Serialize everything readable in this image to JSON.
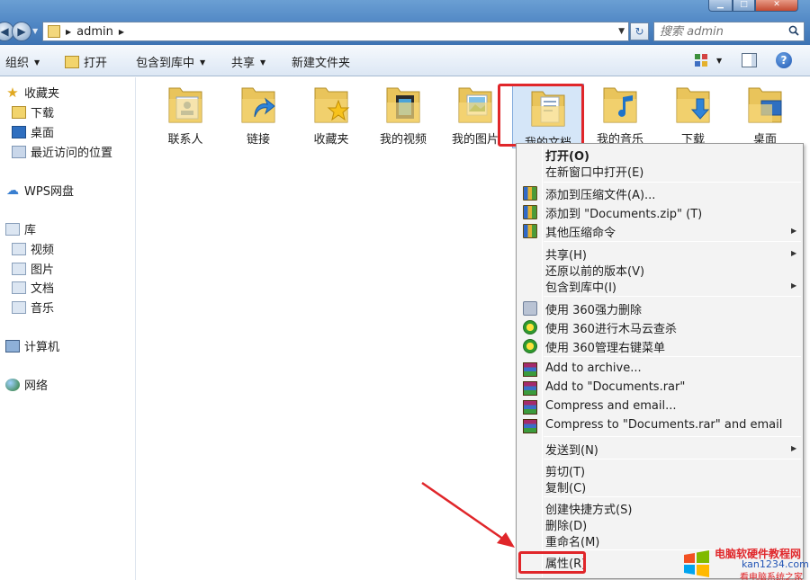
{
  "address_bar": {
    "path": [
      "admin"
    ],
    "search_placeholder": "搜索 admin"
  },
  "toolbar": {
    "organize": "组织",
    "open": "打开",
    "include_in_library": "包含到库中",
    "share": "共享",
    "new_folder": "新建文件夹"
  },
  "sidebar": {
    "favorites": "收藏夹",
    "downloads": "下载",
    "desktop": "桌面",
    "recent": "最近访问的位置",
    "wps": "WPS网盘",
    "libraries": "库",
    "videos": "视频",
    "pictures": "图片",
    "documents": "文档",
    "music": "音乐",
    "computer": "计算机",
    "network": "网络"
  },
  "folders": [
    {
      "label": "联系人",
      "icon": "contacts-folder-icon"
    },
    {
      "label": "链接",
      "icon": "links-folder-icon"
    },
    {
      "label": "收藏夹",
      "icon": "favorites-folder-icon"
    },
    {
      "label": "我的视频",
      "icon": "videos-folder-icon"
    },
    {
      "label": "我的图片",
      "icon": "pictures-folder-icon"
    },
    {
      "label": "我的文档",
      "icon": "documents-folder-icon",
      "selected": true
    },
    {
      "label": "我的音乐",
      "icon": "music-folder-icon"
    },
    {
      "label": "下载",
      "icon": "downloads-folder-icon"
    },
    {
      "label": "桌面",
      "icon": "desktop-folder-icon"
    }
  ],
  "context_menu": {
    "open": "打开(O)",
    "open_new_window": "在新窗口中打开(E)",
    "add_to_zip_archive": "添加到压缩文件(A)...",
    "add_to_documents_zip": "添加到 \"Documents.zip\" (T)",
    "other_compress": "其他压缩命令",
    "share": "共享(H)",
    "restore_previous": "还原以前的版本(V)",
    "include_in_library": "包含到库中(I)",
    "del_360": "使用 360强力删除",
    "scan_360": "使用 360进行木马云查杀",
    "manage_360": "使用 360管理右键菜单",
    "add_to_archive": "Add to archive...",
    "add_to_documents_rar": "Add to \"Documents.rar\"",
    "compress_email": "Compress and email...",
    "compress_rar_email": "Compress to \"Documents.rar\" and email",
    "send_to": "发送到(N)",
    "cut": "剪切(T)",
    "copy": "复制(C)",
    "create_shortcut": "创建快捷方式(S)",
    "delete": "删除(D)",
    "rename": "重命名(M)",
    "properties": "属性(R)"
  },
  "watermark": {
    "line1": "电脑软硬件教程网",
    "line2": "kan1234.com",
    "line3": "看电脑系统之家"
  },
  "colors": {
    "highlight_red": "#e0262a",
    "titlebar_blue": "#4f86c4",
    "selection_blue": "#d5e6f8"
  }
}
